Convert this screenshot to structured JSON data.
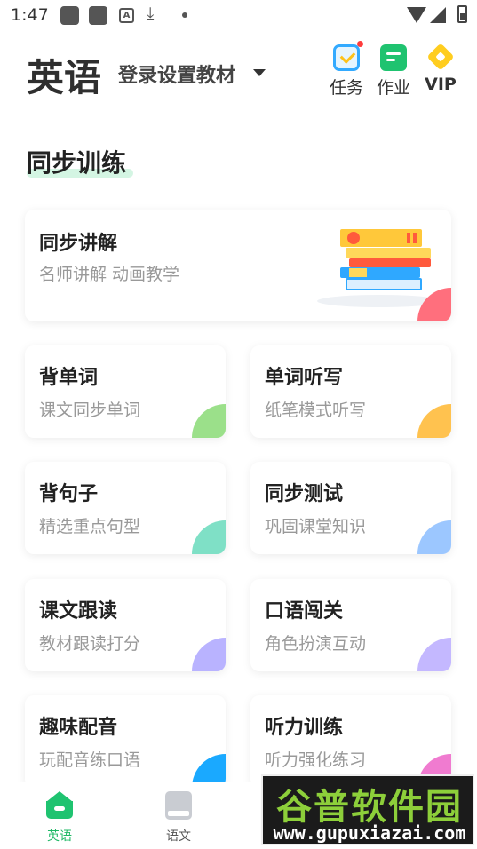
{
  "status_bar": {
    "time": "1:47",
    "a_icon": "A"
  },
  "header": {
    "subject": "英语",
    "textbook_label": "登录设置教材",
    "buttons": [
      {
        "label": "任务",
        "icon": "task-check-icon",
        "has_badge": true,
        "badge_color": "#ff3b3b"
      },
      {
        "label": "作业",
        "icon": "homework-icon"
      },
      {
        "label": "VIP",
        "icon": "vip-diamond-icon"
      }
    ]
  },
  "section": {
    "title": "同步训练"
  },
  "featured_card": {
    "title": "同步讲解",
    "subtitle": "名师讲解 动画教学",
    "accent": "#ff6f7d"
  },
  "cards": [
    {
      "title": "背单词",
      "subtitle": "课文同步单词",
      "accent": "#9be08a"
    },
    {
      "title": "单词听写",
      "subtitle": "纸笔模式听写",
      "accent": "#ffc24f"
    },
    {
      "title": "背句子",
      "subtitle": "精选重点句型",
      "accent": "#7fe0c6"
    },
    {
      "title": "同步测试",
      "subtitle": "巩固课堂知识",
      "accent": "#9cc7ff"
    },
    {
      "title": "课文跟读",
      "subtitle": "教材跟读打分",
      "accent": "#b9b3ff"
    },
    {
      "title": "口语闯关",
      "subtitle": "角色扮演互动",
      "accent": "#c4b8ff"
    },
    {
      "title": "趣味配音",
      "subtitle": "玩配音练口语",
      "accent": "#1aa9ff"
    },
    {
      "title": "听力训练",
      "subtitle": "听力强化练习",
      "accent": "#f07bd0"
    }
  ],
  "tabbar": {
    "tabs": [
      {
        "label": "英语",
        "active": true,
        "icon": "home-icon"
      },
      {
        "label": "语文",
        "active": false,
        "icon": "book-icon"
      }
    ],
    "active_color": "#1fb866"
  },
  "watermark": {
    "line1": "谷普软件园",
    "line2": "www.gupuxiazai.com"
  }
}
